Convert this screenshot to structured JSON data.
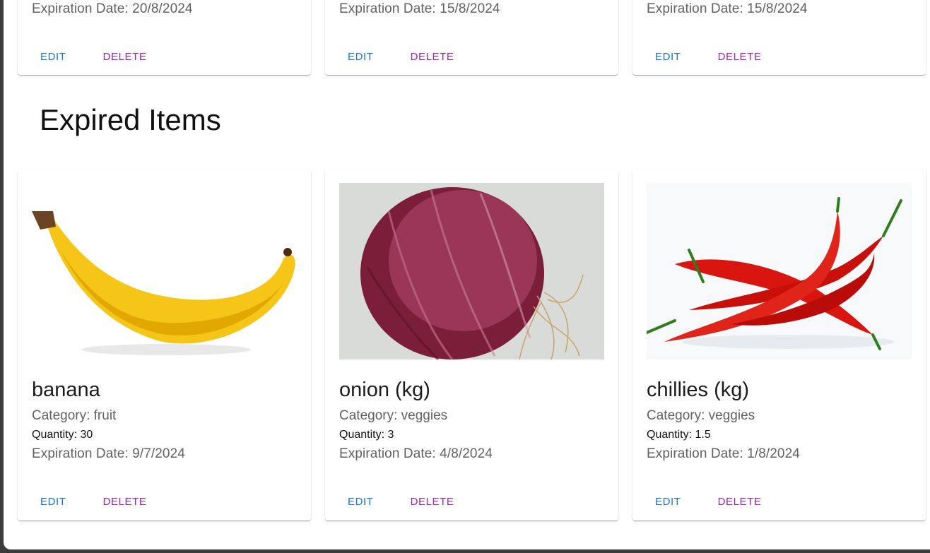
{
  "top_cards": [
    {
      "expiration": "Expiration Date: 20/8/2024",
      "edit": "EDIT",
      "delete": "DELETE"
    },
    {
      "expiration": "Expiration Date: 15/8/2024",
      "edit": "EDIT",
      "delete": "DELETE"
    },
    {
      "expiration": "Expiration Date: 15/8/2024",
      "edit": "EDIT",
      "delete": "DELETE"
    }
  ],
  "section_title": "Expired Items",
  "expired": [
    {
      "name": "banana",
      "category": "Category: fruit",
      "quantity": "Quantity: 30",
      "expiration": "Expiration Date: 9/7/2024",
      "edit": "EDIT",
      "delete": "DELETE",
      "image": "banana"
    },
    {
      "name": "onion (kg)",
      "category": "Category: veggies",
      "quantity": "Quantity: 3",
      "expiration": "Expiration Date: 4/8/2024",
      "edit": "EDIT",
      "delete": "DELETE",
      "image": "red onion"
    },
    {
      "name": "chillies (kg)",
      "category": "Category: veggies",
      "quantity": "Quantity: 1.5",
      "expiration": "Expiration Date: 1/8/2024",
      "edit": "EDIT",
      "delete": "DELETE",
      "image": "red chillies"
    }
  ],
  "colors": {
    "edit": "#1976d2",
    "delete": "#9c27b0",
    "backdrop": "#3b3b3b"
  }
}
